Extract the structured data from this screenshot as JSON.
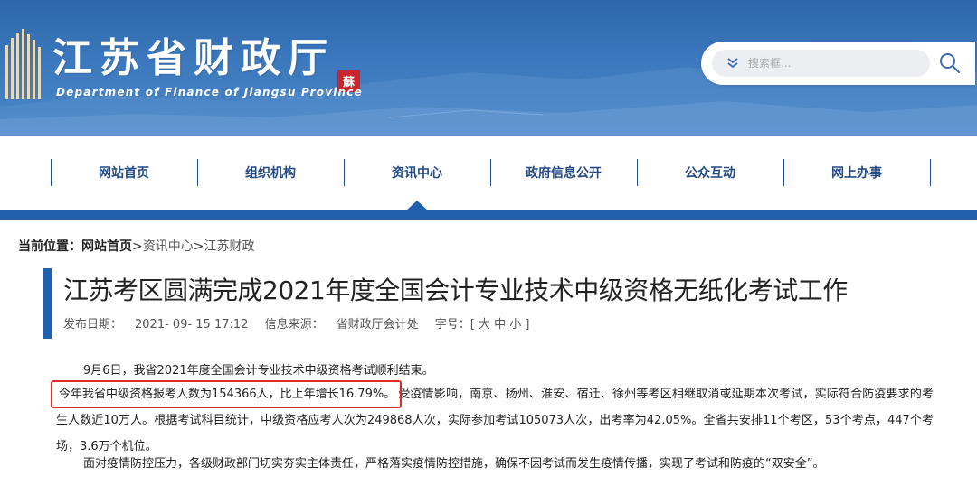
{
  "header": {
    "site_title": "江苏省财政厅",
    "site_subtitle": "Department of Finance of Jiangsu Province",
    "seal_char": "蘇",
    "search": {
      "placeholder": "搜索框..."
    },
    "colors": {
      "header_bg": "#3b78bd",
      "nav_bar": "#2160aa",
      "seal": "#c8262b"
    }
  },
  "nav": {
    "items": [
      {
        "label": "网站首页"
      },
      {
        "label": "组织机构"
      },
      {
        "label": "资讯中心"
      },
      {
        "label": "政府信息公开"
      },
      {
        "label": "公众互动"
      },
      {
        "label": "网上办事"
      }
    ],
    "active_index": 2
  },
  "breadcrumb": {
    "label": "当前位置：",
    "home": "网站首页",
    "sep1": ">",
    "item1": "资讯中心",
    "sep2": ">",
    "item2": "江苏财政"
  },
  "article": {
    "title": "江苏考区圆满完成2021年度全国会计专业技术中级资格无纸化考试工作",
    "meta": {
      "publish_label": "发布日期：",
      "publish_date": "2021- 09- 15  17:12",
      "source_label": "信息来源：",
      "source": "省财政厅会计处",
      "font_label": "字号：",
      "font_sizes": "[ 大 中 小 ]"
    },
    "paragraphs": {
      "p1": "9月6日，我省2021年度全国会计专业技术中级资格考试顺利结束。",
      "p2_highlight": "今年我省中级资格报考人数为154366人，比上年增长16.79%。",
      "p2_rest": "受疫情影响，南京、扬州、淮安、宿迁、徐州等考区相继取消或延期本次考试，实际符合防疫要求的考生人数近10万人。根据考试科目统计，中级资格应考人次为249868人次，实际参加考试105073人次，出考率为42.05%。全省共安排11个考区，53个考点，447个考场，3.6万个机位。",
      "p3": "面对疫情防控压力，各级财政部门切实夯实主体责任，严格落实疫情防控措施，确保不因考试而发生疫情传播，实现了考试和防疫的“双安全”。"
    }
  }
}
